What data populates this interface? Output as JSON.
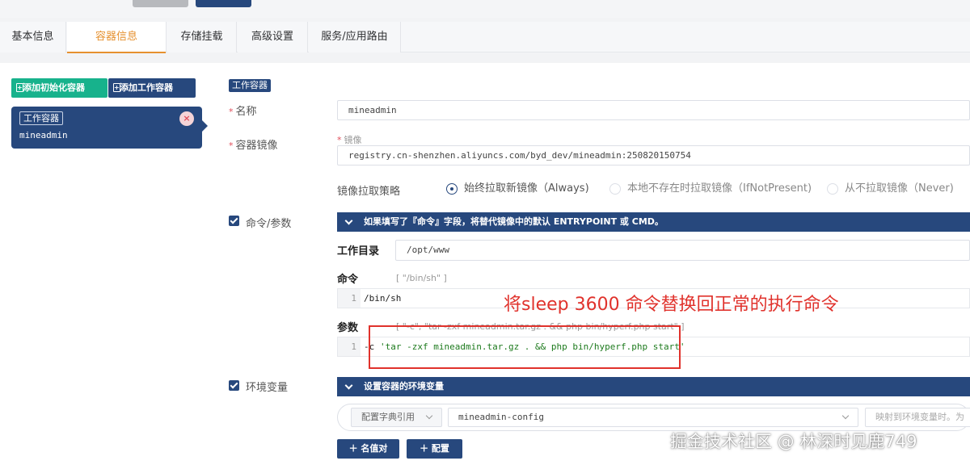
{
  "tabs": [
    {
      "label": "基本信息"
    },
    {
      "label": "容器信息"
    },
    {
      "label": "存储挂载"
    },
    {
      "label": "高级设置"
    },
    {
      "label": "服务/应用路由"
    }
  ],
  "left": {
    "add_init_label": "添加初始化容器",
    "add_work_label": "添加工作容器",
    "card": {
      "tag": "工作容器",
      "name": "mineadmin",
      "close": "×"
    }
  },
  "form": {
    "badge": "工作容器",
    "name_label": "名称",
    "name_value": "mineadmin",
    "image_label": "容器镜像",
    "image_sublabel": "镜像",
    "image_value": "registry.cn-shenzhen.aliyuncs.com/byd_dev/mineadmin:250820150754",
    "pull_policy_label": "镜像拉取策略",
    "pull_options": [
      {
        "label": "始终拉取新镜像（Always)",
        "selected": true
      },
      {
        "label": "本地不存在时拉取镜像（IfNotPresent)",
        "selected": false
      },
      {
        "label": "从不拉取镜像（Never)",
        "selected": false
      }
    ],
    "command_section_label": "命令/参数",
    "command_panel_title": "如果填写了『命令』字段，将替代镜像中的默认 ENTRYPOINT 或 CMD。",
    "workdir_label": "工作目录",
    "workdir_value": "/opt/www",
    "command_label": "命令",
    "command_hint": "[ \"/bin/sh\" ]",
    "command_line_no": "1",
    "command_code": "/bin/sh",
    "args_label": "参数",
    "args_hint": "[ \"-c\", \"tar -zxf mineadmin.tar.gz . && php bin/hyperf.php start\" ]",
    "args_line_no": "1",
    "args_flag": "-c",
    "args_code": "'tar -zxf mineadmin.tar.gz . && php bin/hyperf.php start'",
    "env_section_label": "环境变量",
    "env_panel_title": "设置容器的环境变量",
    "env_source_select": "配置字典引用",
    "env_config_select": "mineadmin-config",
    "env_map_placeholder": "映射到环境变量时。为",
    "add_kv_label": "名值对",
    "add_config_label": "配置"
  },
  "annotation": {
    "text": "将sleep 3600 命令替换回正常的执行命令",
    "color": "#e0322c"
  },
  "watermark": "掘金技术社区 @ 林深时见鹿749",
  "colors": {
    "primary": "#27487d",
    "accent": "#e6912f",
    "success": "#17b28c",
    "danger": "#e0322c"
  }
}
